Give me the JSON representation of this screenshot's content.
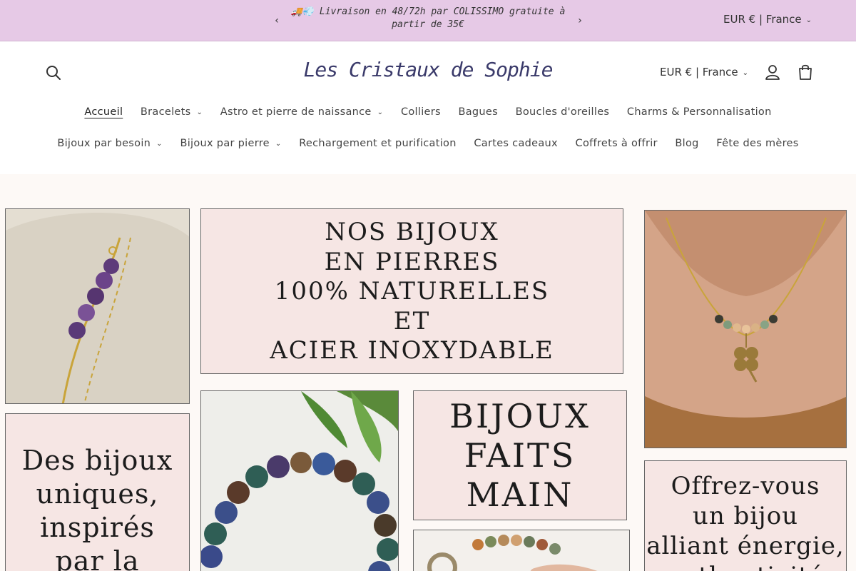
{
  "announcement": {
    "message": "🚚💨 Livraison en 48/72h par COLISSIMO gratuite à partir de 35€",
    "currency": "EUR € | France"
  },
  "header": {
    "logo": "Les Cristaux de Sophie",
    "currency": "EUR € | France"
  },
  "nav": {
    "row1": [
      {
        "label": "Accueil",
        "active": true,
        "dropdown": false
      },
      {
        "label": "Bracelets",
        "dropdown": true
      },
      {
        "label": "Astro et pierre de naissance",
        "dropdown": true
      },
      {
        "label": "Colliers",
        "dropdown": false
      },
      {
        "label": "Bagues",
        "dropdown": false
      },
      {
        "label": "Boucles d'oreilles",
        "dropdown": false
      },
      {
        "label": "Charms & Personnalisation",
        "dropdown": false
      }
    ],
    "row2": [
      {
        "label": "Bijoux par besoin",
        "dropdown": true
      },
      {
        "label": "Bijoux par pierre",
        "dropdown": true
      },
      {
        "label": "Rechargement et purification",
        "dropdown": false
      },
      {
        "label": "Cartes cadeaux",
        "dropdown": false
      },
      {
        "label": "Coffrets à offrir",
        "dropdown": false
      },
      {
        "label": "Blog",
        "dropdown": false
      },
      {
        "label": "Fête des mères",
        "dropdown": false
      }
    ]
  },
  "hero": {
    "tile_natural": [
      "NOS BIJOUX",
      "EN PIERRES",
      "100% NATURELLES",
      "ET",
      "ACIER INOXYDABLE"
    ],
    "tile_unique": [
      "Des bijoux",
      "uniques,",
      "inspirés",
      "par la"
    ],
    "tile_handmade": [
      "BIJOUX",
      "FAITS",
      "MAIN"
    ],
    "tile_offer": [
      "Offrez-vous",
      "un bijou",
      "alliant énergie,",
      "authenticité"
    ]
  },
  "colors": {
    "announcement_bg": "#e6c9e6",
    "tile_pink": "#f6e6e4",
    "logo": "#3a3a6a"
  }
}
